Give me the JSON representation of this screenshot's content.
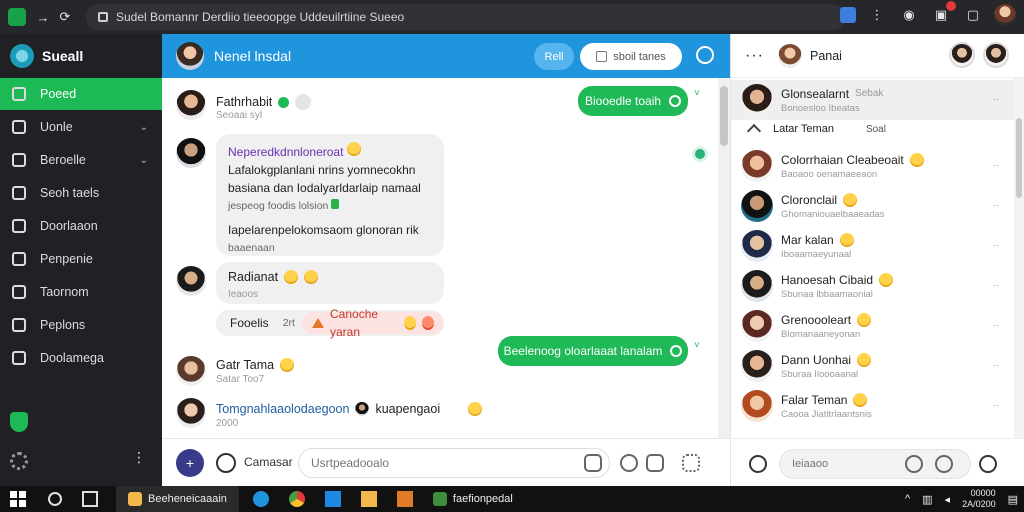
{
  "browser": {
    "url_text": "Sudel Bomannr  Derdiio tieeoopge  Uddeuilrtiine Sueeo",
    "notification_count": "1"
  },
  "sidebar": {
    "app_name": "Sueall",
    "items": [
      {
        "label": "Poeed",
        "active": true,
        "has_chevron": false,
        "icon": "home-icon"
      },
      {
        "label": "Uonle",
        "active": false,
        "has_chevron": true,
        "icon": "list-icon"
      },
      {
        "label": "Beroelle",
        "active": false,
        "has_chevron": true,
        "icon": "video-icon"
      },
      {
        "label": "Seoh taels",
        "active": false,
        "has_chevron": false,
        "icon": "people-icon"
      },
      {
        "label": "Doorlaaon",
        "active": false,
        "has_chevron": false,
        "icon": "chat-icon"
      },
      {
        "label": "Penpenie",
        "active": false,
        "has_chevron": false,
        "icon": "edit-icon"
      },
      {
        "label": "Taornom",
        "active": false,
        "has_chevron": false,
        "icon": "bookmark-icon"
      },
      {
        "label": "Peplons",
        "active": false,
        "has_chevron": false,
        "icon": "page-icon"
      },
      {
        "label": "Doolamega",
        "active": false,
        "has_chevron": false,
        "icon": "settings-icon"
      }
    ]
  },
  "chat": {
    "title": "Nenel lnsdal",
    "btn_blue": "Rell",
    "btn_white": "sboil tanes",
    "messages": {
      "m1": {
        "name": "Fathrhabit",
        "sub": "Seoaai syl"
      },
      "m1_reply": "Biooedle toaih",
      "m2": {
        "name": "Neperedkdnnloneroat",
        "line1": "Lafalokgplanlani nrins yomnecokhn",
        "line2": "basiana dan Iodalyarldarlaip namaal",
        "line3": "jespeog foodis lolsion",
        "line4": "Iapelarenpelokomsaom glonoran rik",
        "line5": "baaenaan"
      },
      "m3": {
        "name": "Radianat",
        "sub": "Ieaoos"
      },
      "m3_tag": "Fooelis",
      "m3_tag2": "2rt",
      "m3_pink": "Canoche yaran",
      "m4_reply": "Beelenoog oloarlaaat lanalam",
      "m4": {
        "name": "Gatr Tama",
        "sub": "Satar Too7"
      },
      "m5": {
        "name": "Tomgnahlaaolodaegoon",
        "name2": "kuapengaoi",
        "sub": "2000"
      }
    },
    "composer": {
      "label": "Camasar",
      "placeholder": "Usrtpeadooalo"
    }
  },
  "right_panel": {
    "header_name": "Panai",
    "section_label": "Latar Teman",
    "section_badge": "Soal",
    "contacts": [
      {
        "name": "Glonsealarnt",
        "name_suffix": "Sebak",
        "sub": "Bonoesloo Ibeatas",
        "highlight": true
      },
      {
        "name": "Colorrhaian Cleabeoait",
        "sub": "Baoaoo oenamaeeaon",
        "highlight": false
      },
      {
        "name": "Cloronclail",
        "sub": "Ghomaniouaelbaaeadas",
        "highlight": false
      },
      {
        "name": "Mar kalan",
        "sub": "Iboaamaeyunaal",
        "highlight": false
      },
      {
        "name": "Hanoesah Cibaid",
        "sub": "Sbunaa lbbaamaonial",
        "highlight": false
      },
      {
        "name": "Grenoooleart",
        "sub": "Blomanaaneyonan",
        "highlight": false
      },
      {
        "name": "Dann Uonhai",
        "sub": "Sburaa Iloooaanal",
        "highlight": false
      },
      {
        "name": "Falar Teman",
        "sub": "Caooa Jiatitrlaantsnis",
        "highlight": false
      }
    ],
    "composer_placeholder": "Ieiaaoo"
  },
  "taskbar": {
    "search_app": "Beeheneicaaain",
    "app2": "faefionpedal",
    "time_line1": "00000",
    "time_line2": "2A/0200"
  },
  "colors": {
    "accent_green": "#1db954",
    "header_blue": "#1e95dc",
    "sidebar_bg": "#202125"
  }
}
